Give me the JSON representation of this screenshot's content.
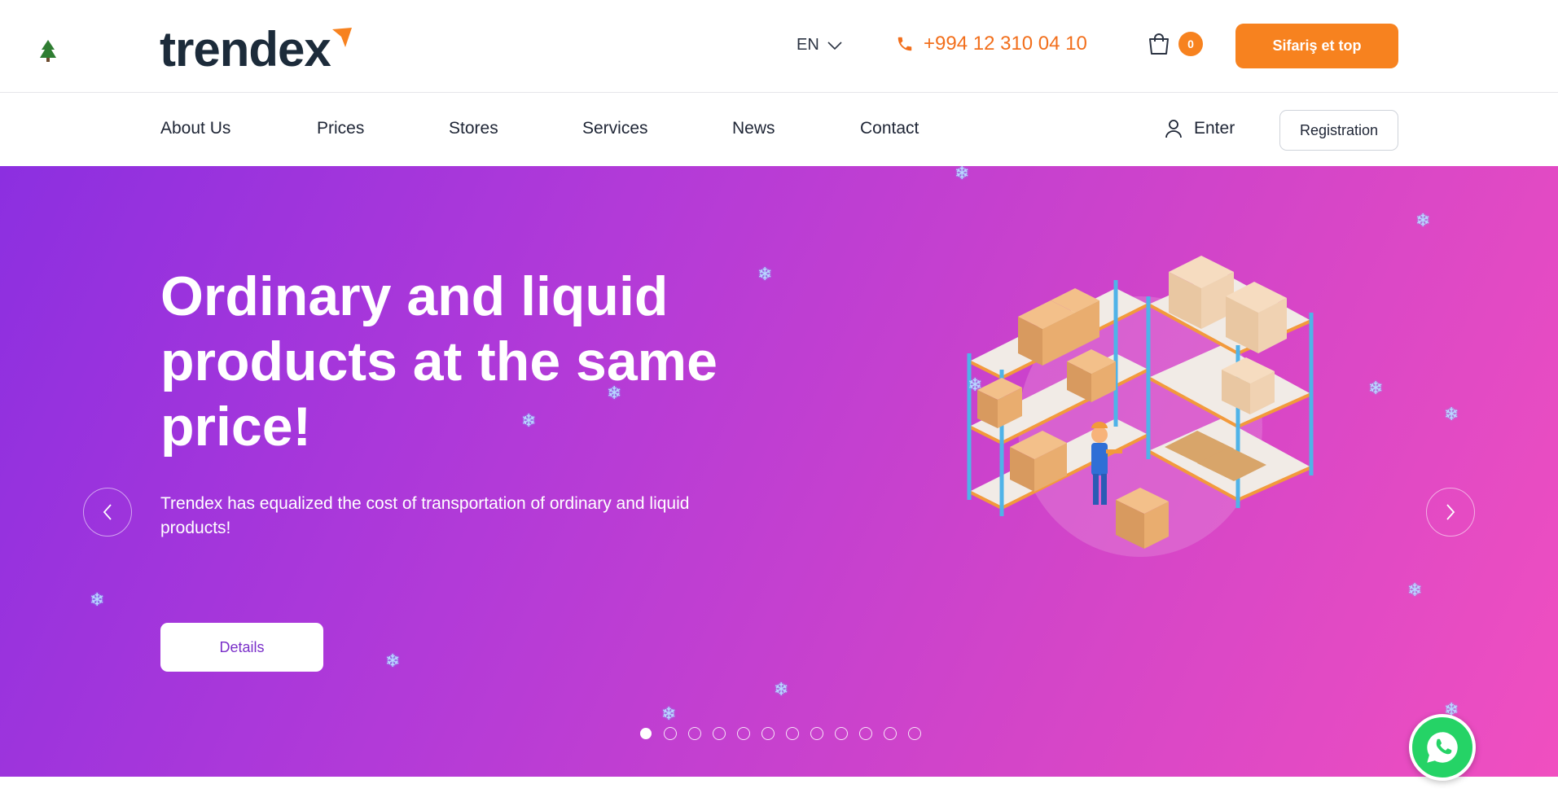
{
  "header": {
    "logo_text": "trendex",
    "language": "EN",
    "phone": "+994 12 310 04 10",
    "cart_count": "0",
    "order_button": "Sifariş et top"
  },
  "nav": {
    "items": [
      {
        "label": "About Us"
      },
      {
        "label": "Prices"
      },
      {
        "label": "Stores"
      },
      {
        "label": "Services"
      },
      {
        "label": "News"
      },
      {
        "label": "Contact"
      }
    ],
    "enter_label": "Enter",
    "registration_label": "Registration"
  },
  "hero": {
    "title": "Ordinary and liquid products at the same price!",
    "subtitle": "Trendex has equalized the cost of transportation of ordinary and liquid products!",
    "details_button": "Details",
    "slide_count": 12,
    "active_slide": 1
  },
  "colors": {
    "accent_orange": "#f7821f",
    "phone_orange": "#f26f1c",
    "hero_gradient_start": "#8c2fe0",
    "hero_gradient_end": "#f04fc0",
    "whatsapp_green": "#25d366"
  },
  "icons": [
    "tree-icon",
    "logo-mark-icon",
    "chevron-down-icon",
    "phone-icon",
    "cart-icon",
    "user-icon",
    "arrow-left-icon",
    "arrow-right-icon",
    "whatsapp-icon",
    "snowflake-icon"
  ]
}
